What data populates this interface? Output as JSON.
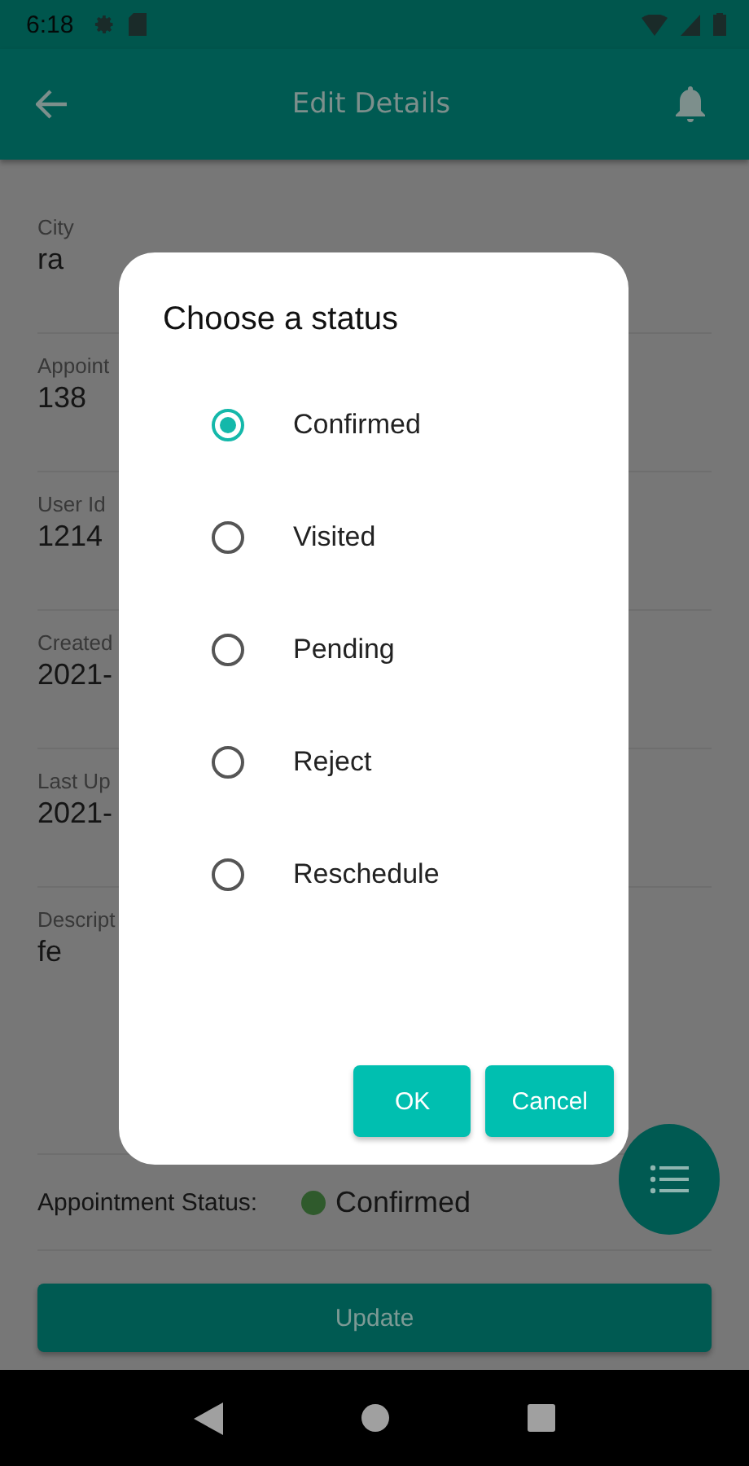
{
  "status_bar": {
    "time": "6:18"
  },
  "app_bar": {
    "title": "Edit Details"
  },
  "fields": [
    {
      "label": "City",
      "value": "ra"
    },
    {
      "label": "Appoint",
      "value": "138"
    },
    {
      "label": "User Id",
      "value": "1214"
    },
    {
      "label": "Created",
      "value": "2021-"
    },
    {
      "label": "Last Up",
      "value": "2021-"
    },
    {
      "label": "Descript",
      "value": "fe"
    }
  ],
  "appointment_status": {
    "label": "Appointment Status:",
    "value": "Confirmed",
    "color": "#2f5a2c"
  },
  "update_button": "Update",
  "dialog": {
    "title": "Choose a status",
    "options": [
      {
        "label": "Confirmed",
        "selected": true
      },
      {
        "label": "Visited",
        "selected": false
      },
      {
        "label": "Pending",
        "selected": false
      },
      {
        "label": "Reject",
        "selected": false
      },
      {
        "label": "Reschedule",
        "selected": false
      }
    ],
    "buttons": [
      "OK",
      "Cancel"
    ]
  }
}
